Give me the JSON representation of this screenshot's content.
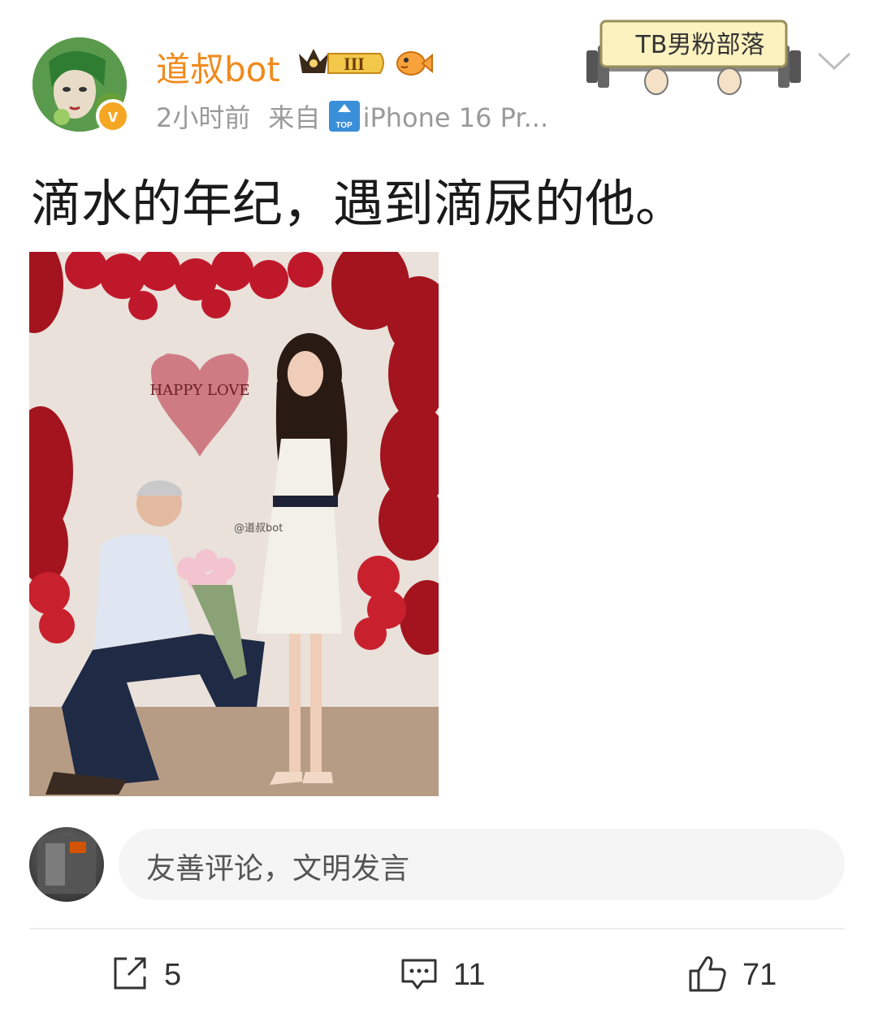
{
  "post": {
    "username": "道叔bot",
    "vip_level": "III",
    "time": "2小时前",
    "source_prefix": "来自",
    "source_device": "iPhone 16 Pr...",
    "group_badge": "TB男粉部落",
    "text": "滴水的年纪，遇到滴尿的他。",
    "image_watermark": "@道叔bot",
    "image_sign_text": "HAPPY LOVE"
  },
  "comment": {
    "placeholder": "友善评论，文明发言"
  },
  "actions": {
    "share_count": "5",
    "comment_count": "11",
    "like_count": "71"
  },
  "icons": {
    "verified": "v-verified-icon",
    "vip": "crown-vip-icon",
    "fish": "fish-badge-icon",
    "top": "top-arrow-icon",
    "more": "chevron-down-icon",
    "share": "share-icon",
    "comment": "comment-icon",
    "like": "thumbs-up-icon"
  },
  "colors": {
    "username": "#f08a1c",
    "meta": "#9a9a9a",
    "verified": "#f5a623"
  }
}
